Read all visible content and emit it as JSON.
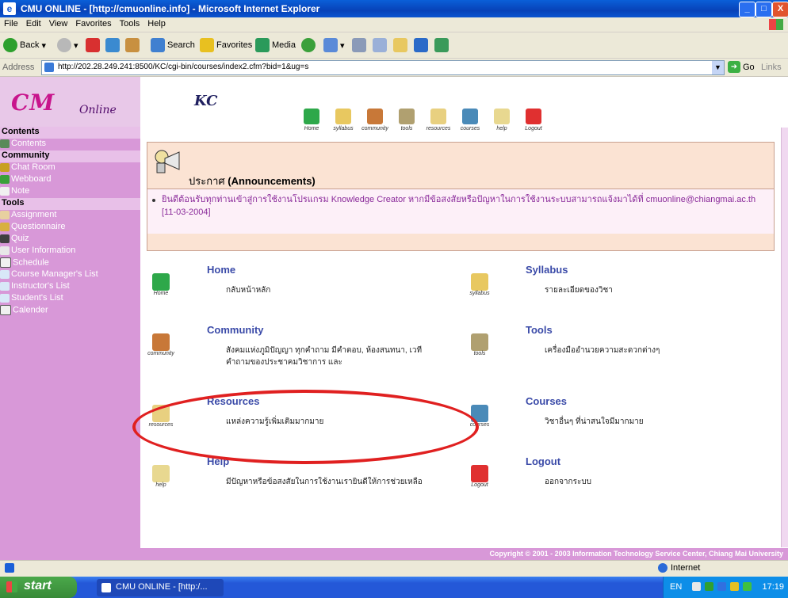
{
  "window": {
    "title": "CMU ONLINE - [http://cmuonline.info] - Microsoft Internet Explorer",
    "controls": [
      "_",
      "□",
      "X"
    ]
  },
  "menu": [
    "File",
    "Edit",
    "View",
    "Favorites",
    "Tools",
    "Help"
  ],
  "toolbar": {
    "back": "Back",
    "search": "Search",
    "favorites": "Favorites",
    "media": "Media"
  },
  "address": {
    "label": "Address",
    "url": "http://202.28.249.241:8500/KC/cgi-bin/courses/index2.cfm?bid=1&ug=s",
    "go": "Go",
    "links": "Links"
  },
  "logo": {
    "cm": "CM",
    "online": "Online"
  },
  "sidebar": {
    "sections": [
      {
        "title": "Contents",
        "items": [
          "Contents"
        ]
      },
      {
        "title": "Community",
        "items": [
          "Chat Room",
          "Webboard",
          "Note"
        ]
      },
      {
        "title": "Tools",
        "items": [
          "Assignment",
          "Questionnaire",
          "Quiz",
          "User Information",
          "Schedule",
          "Course Manager's List",
          "Instructor's List",
          "Student's List",
          "Calender"
        ]
      }
    ]
  },
  "kc": "KC",
  "top_icons": [
    "Home",
    "syllabus",
    "community",
    "tools",
    "resources",
    "courses",
    "help",
    "Logout"
  ],
  "announcement": {
    "title_thai": "ประกาศ",
    "title_en": "(Announcements)",
    "text": "ยินดีต้อนรับทุกท่านเข้าสู่การใช้งานโปรแกรม Knowledge Creator หากมีข้อสงสัยหรือปัญหาในการใช้งานระบบสามารถแจ้งมาได้ที่ cmuonline@chiangmai.ac.th",
    "date": "[11-03-2004]"
  },
  "menu_items": [
    {
      "heading": "Home",
      "caption": "Home",
      "desc": "กลับหน้าหลัก"
    },
    {
      "heading": "Syllabus",
      "caption": "syllabus",
      "desc": "รายละเอียดของวิชา"
    },
    {
      "heading": "Community",
      "caption": "community",
      "desc": "สังคมแห่งภูมิปัญญา ทุกคำถาม มีคำตอบ, ห้องสนทนา, เวทีคำถามของประชาคมวิชาการ และ"
    },
    {
      "heading": "Tools",
      "caption": "tools",
      "desc": "เครื่องมืออำนวยความสะดวกต่างๆ"
    },
    {
      "heading": "Resources",
      "caption": "resources",
      "desc": "แหล่งความรู้เพิ่มเติมมากมาย"
    },
    {
      "heading": "Courses",
      "caption": "courses",
      "desc": "วิชาอื่นๆ ที่น่าสนใจมีมากมาย"
    },
    {
      "heading": "Help",
      "caption": "help",
      "desc": "มีปัญหาหรือข้อสงสัยในการใช้งานเรายินดีให้การช่วยเหลือ"
    },
    {
      "heading": "Logout",
      "caption": "Logout",
      "desc": "ออกจากระบบ"
    }
  ],
  "footer": "Copyright © 2001 - 2003 Information Technology Service Center, Chiang Mai University",
  "status": {
    "zone": "Internet"
  },
  "taskbar": {
    "start": "start",
    "task": "CMU ONLINE - [http:/...",
    "lang": "EN",
    "time": "17:19"
  }
}
